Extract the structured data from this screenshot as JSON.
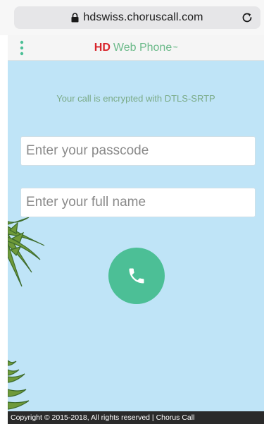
{
  "browser": {
    "url": "hdswiss.choruscall.com"
  },
  "header": {
    "title_hd": "HD",
    "title_rest": "Web Phone",
    "title_tm": "™"
  },
  "main": {
    "encryption_message": "Your call is encrypted with DTLS-SRTP",
    "passcode_placeholder": "Enter your passcode",
    "fullname_placeholder": "Enter your full name"
  },
  "footer": {
    "copyright": "Copyright © 2015-2018, All rights reserved | Chorus Call"
  },
  "colors": {
    "background": "#bfe4f7",
    "call_button": "#4cbf96",
    "brand_red": "#d8242b",
    "brand_green": "#6cba8a"
  },
  "icons": [
    "lock-icon",
    "reload-icon",
    "menu-icon",
    "phone-icon",
    "palm-leaves-decoration"
  ]
}
